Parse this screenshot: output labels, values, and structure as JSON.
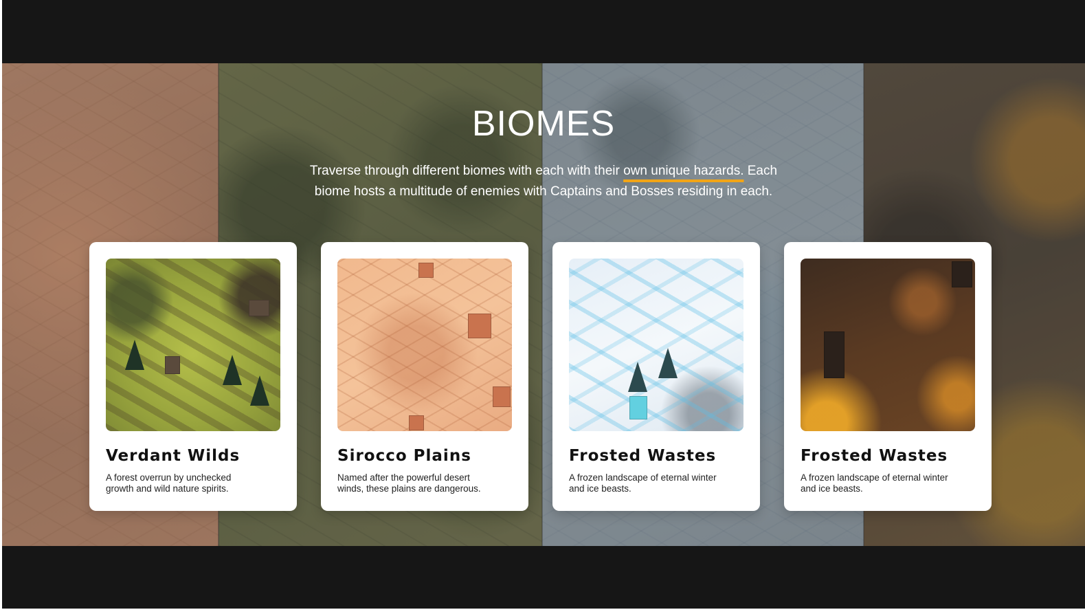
{
  "section": {
    "title": "BIOMES",
    "subtitle_before": "Traverse through different biomes with each with their ",
    "subtitle_highlight": "own unique hazards.",
    "subtitle_after": " Each biome hosts a multitude of enemies with Captains and Bosses residing in each.",
    "highlight_color": "#f2a516"
  },
  "cards": [
    {
      "title": "Verdant Wilds",
      "description": "A forest overrun by unchecked growth and wild nature spirits.",
      "image": "forest-biome-image"
    },
    {
      "title": "Sirocco Plains",
      "description": "Named after the powerful desert winds, these plains are dangerous.",
      "image": "desert-biome-image"
    },
    {
      "title": "Frosted Wastes",
      "description": "A frozen landscape of eternal winter and ice beasts.",
      "image": "snow-biome-image"
    },
    {
      "title": "Frosted Wastes",
      "description": "A frozen landscape of eternal winter and ice beasts.",
      "image": "lava-biome-image"
    }
  ]
}
